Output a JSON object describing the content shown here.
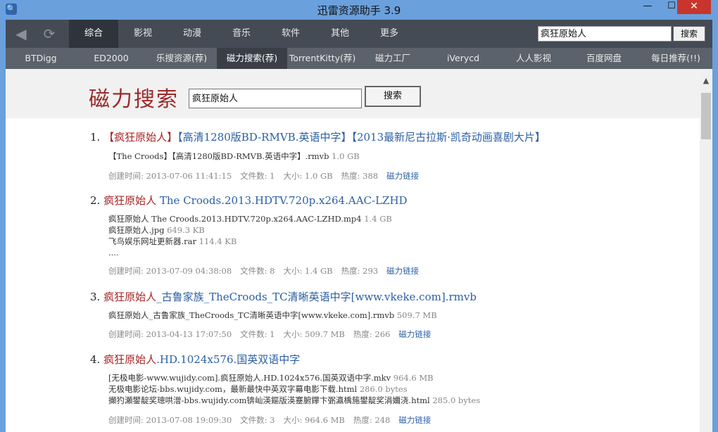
{
  "window": {
    "title": "迅雷资源助手 3.9",
    "min": "—",
    "max": "☐",
    "close": "✕"
  },
  "nav": {
    "categories": [
      "综合",
      "影视",
      "动漫",
      "音乐",
      "软件",
      "其他",
      "更多"
    ],
    "top_search_value": "疯狂原始人",
    "top_search_button": "搜索"
  },
  "sites": [
    "BTDigg",
    "ED2000",
    "乐搜资源(荐)",
    "磁力搜索(荐)",
    "TorrentKitty(荐)",
    "磁力工厂",
    "iVerycd",
    "人人影视",
    "百度网盘",
    "每日推荐(!!)"
  ],
  "header": {
    "logo": "磁力搜索",
    "query": "疯狂原始人",
    "button": "搜索"
  },
  "results": [
    {
      "num": "1.",
      "hl": "【疯狂原始人】",
      "rest": "【高清1280版BD-RMVB.英语中字】【2013最新尼古拉斯·凯奇动画喜剧大片】",
      "files": [
        {
          "name": "【The Croods】【高清1280版BD-RMVB.英语中字】.rmvb",
          "size": "1.0 GB"
        }
      ],
      "created": "创建时间: 2013-07-06 11:41:15",
      "count": "文件数: 1",
      "size": "大小: 1.0 GB",
      "heat": "热度: 388",
      "magnet": "磁力链接"
    },
    {
      "num": "2.",
      "hl": "疯狂原始人",
      "rest": " The Croods.2013.HDTV.720p.x264.AAC-LZHD",
      "files": [
        {
          "name": "疯狂原始人 The Croods.2013.HDTV.720p.x264.AAC-LZHD.mp4",
          "size": "1.4 GB"
        },
        {
          "name": "疯狂原始人.jpg",
          "size": "649.3 KB"
        },
        {
          "name": "飞鸟娱乐网址更新器.rar",
          "size": "114.4 KB"
        },
        {
          "name": "....",
          "size": ""
        }
      ],
      "created": "创建时间: 2013-07-09 04:38:08",
      "count": "文件数: 8",
      "size": "大小: 1.4 GB",
      "heat": "热度: 293",
      "magnet": "磁力链接"
    },
    {
      "num": "3.",
      "hl": "疯狂原始人",
      "rest": "_古鲁家族_TheCroods_TC清晰英语中字[www.vkeke.com].rmvb",
      "files": [
        {
          "name": "疯狂原始人_古鲁家族_TheCroods_TC清晰英语中字[www.vkeke.com].rmvb",
          "size": "509.7 MB"
        }
      ],
      "created": "创建时间: 2013-04-13 17:07:50",
      "count": "文件数: 1",
      "size": "大小: 509.7 MB",
      "heat": "热度: 266",
      "magnet": "磁力链接"
    },
    {
      "num": "4.",
      "hl": "疯狂原始人",
      "rest": ".HD.1024x576.国英双语中字",
      "files": [
        {
          "name": "[无极电影-www.wujidy.com].疯狂原始人.HD.1024x576.国英双语中字.mkv",
          "size": "964.6 MB"
        },
        {
          "name": "无极电影论坛-bbs.wujidy.com，最新最快中英双字幕电影下载.html",
          "size": "286.0 bytes"
        },
        {
          "name": "攧犳瀬鐢靛奖璁哄潧-bbs.wujidy.com锛屾渶鏂版渶蹇腑鑻卞弻瀛楀箷鐢靛奖涓嬭浇.html",
          "size": "285.0 bytes"
        }
      ],
      "created": "创建时间: 2013-07-08 19:09:30",
      "count": "文件数: 3",
      "size": "大小: 964.6 MB",
      "heat": "热度: 248",
      "magnet": "磁力链接"
    }
  ]
}
